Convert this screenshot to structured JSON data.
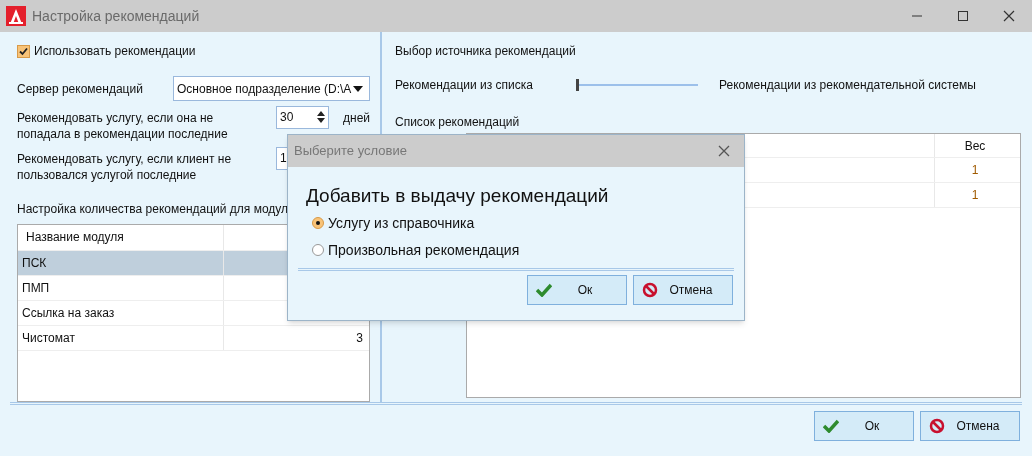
{
  "window": {
    "title": "Настройка рекомендаций"
  },
  "left": {
    "use_checkbox": {
      "label": "Использовать рекомендации",
      "checked": true
    },
    "server": {
      "label": "Сервер рекомендаций",
      "value": "Основное подразделение (D:\\A"
    },
    "spinners": [
      {
        "label": "Рекомендовать услугу, если она не попадала в рекомендации последние",
        "value": "30",
        "unit": "дней"
      },
      {
        "label": "Рекомендовать услугу, если клиент не пользовался услугой последние",
        "value": "1"
      }
    ],
    "modules_label": "Настройка количества рекомендаций для модул",
    "modules_table": {
      "columns": [
        "Название модуля"
      ],
      "rows": [
        {
          "cells": [
            "ПСК"
          ],
          "selected": true
        },
        {
          "cells": [
            "ПМП"
          ],
          "selected": false
        },
        {
          "cells": [
            "Ссылка на заказ"
          ],
          "selected": false
        },
        {
          "cells": [
            "Чистомат",
            "3"
          ],
          "selected": false
        }
      ]
    }
  },
  "right": {
    "source_label": "Выбор источника рекомендаций",
    "slider": {
      "left_label": "Рекомендации из списка",
      "right_label": "Рекомендации из рекомендательной системы",
      "level": 0
    },
    "list_label": "Список рекомендаций",
    "list_table": {
      "columns": [
        "Вес"
      ],
      "rows": [
        [
          "1"
        ],
        [
          "1"
        ]
      ]
    }
  },
  "buttons": [
    {
      "label": "Ок"
    },
    {
      "label": "Отмена"
    }
  ],
  "dialog": {
    "title": "Выберите условие",
    "heading": "Добавить в выдачу рекомендаций",
    "options": [
      {
        "label": "Услугу из справочника",
        "selected": true
      },
      {
        "label": "Произвольная рекомендация",
        "selected": false
      }
    ],
    "buttons": [
      {
        "label": "Ок"
      },
      {
        "label": "Отмена"
      }
    ]
  }
}
